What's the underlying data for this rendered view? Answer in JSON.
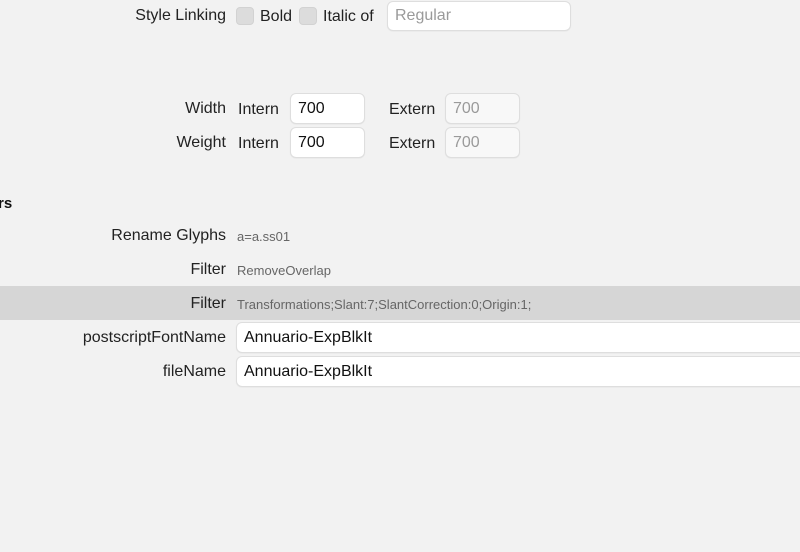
{
  "style_linking": {
    "label": "Style Linking",
    "bold_label": "Bold",
    "italic_label": "Italic of",
    "italic_of_placeholder": "Regular"
  },
  "axes": {
    "width": {
      "label": "Width",
      "intern_label": "Intern",
      "intern_value": "700",
      "extern_label": "Extern",
      "extern_placeholder": "700"
    },
    "weight": {
      "label": "Weight",
      "intern_label": "Intern",
      "intern_value": "700",
      "extern_label": "Extern",
      "extern_placeholder": "700"
    }
  },
  "section": {
    "heading_fragment": "rs"
  },
  "custom_parameters": [
    {
      "name": "Rename Glyphs",
      "value": "a=a.ss01"
    },
    {
      "name": "Filter",
      "value": "RemoveOverlap"
    },
    {
      "name": "Filter",
      "value": "Transformations;Slant:7;SlantCorrection:0;Origin:1;"
    }
  ],
  "properties": {
    "postscript_font_name": {
      "label": "postscriptFontName",
      "value": "Annuario-ExpBlkIt"
    },
    "file_name": {
      "label": "fileName",
      "value": "Annuario-ExpBlkIt"
    }
  },
  "colors": {
    "background": "#f2f2f2",
    "selected_row": "#d6d6d6",
    "field_background": "#ffffff"
  }
}
